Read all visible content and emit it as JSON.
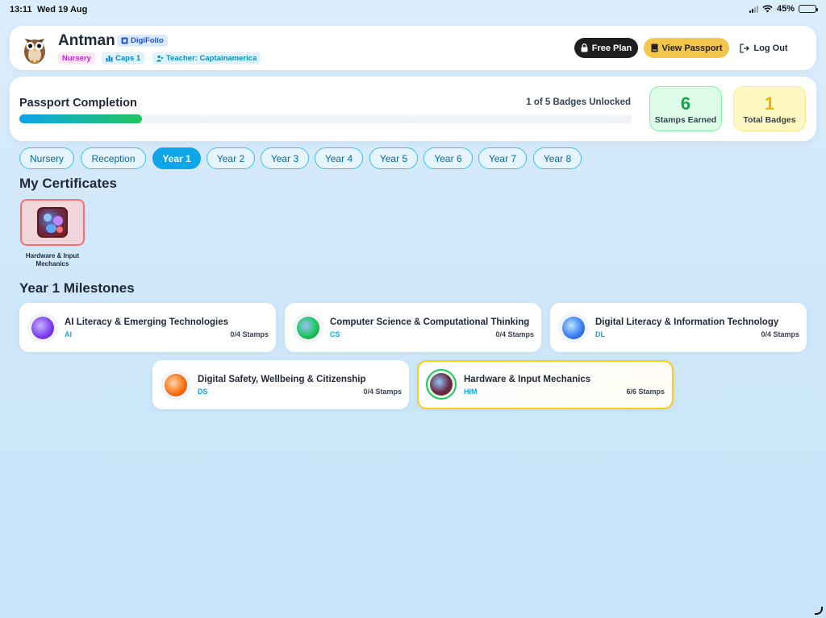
{
  "status_bar": {
    "time": "13:11",
    "date": "Wed 19 Aug",
    "battery": "45%",
    "battery_level": 0.45
  },
  "header": {
    "username": "Antman",
    "digifolio_label": "DigiFolio",
    "grade_label": "Nursery",
    "class_label": "Caps 1",
    "teacher_label": "Teacher: Captainamerica",
    "free_plan_label": "Free Plan",
    "view_passport_label": "View Passport",
    "logout_label": "Log Out"
  },
  "completion": {
    "title": "Passport Completion",
    "unlocked_text": "1 of 5 Badges Unlocked",
    "progress": 0.2,
    "stamps_earned_value": "6",
    "stamps_earned_label": "Stamps Earned",
    "total_badges_value": "1",
    "total_badges_label": "Total Badges"
  },
  "year_tabs": [
    {
      "label": "Nursery",
      "active": false
    },
    {
      "label": "Reception",
      "active": false
    },
    {
      "label": "Year 1",
      "active": true
    },
    {
      "label": "Year 2",
      "active": false
    },
    {
      "label": "Year 3",
      "active": false
    },
    {
      "label": "Year 4",
      "active": false
    },
    {
      "label": "Year 5",
      "active": false
    },
    {
      "label": "Year 6",
      "active": false
    },
    {
      "label": "Year 7",
      "active": false
    },
    {
      "label": "Year 8",
      "active": false
    }
  ],
  "certificates": {
    "title": "My Certificates",
    "items": [
      {
        "label": "Hardware & Input Mechanics"
      }
    ]
  },
  "milestones": {
    "title": "Year 1 Milestones",
    "items": [
      {
        "name": "AI Literacy & Emerging Technologies",
        "code": "AI",
        "stamps": "0/4 Stamps",
        "color": "#7c3aed"
      },
      {
        "name": "Computer Science & Computational Thinking",
        "code": "CS",
        "stamps": "0/4 Stamps",
        "color": "#16a34a"
      },
      {
        "name": "Digital Literacy & Information Technology",
        "code": "DL",
        "stamps": "0/4 Stamps",
        "color": "#2563eb"
      },
      {
        "name": "Digital Safety, Wellbeing & Citizenship",
        "code": "DS",
        "stamps": "0/4 Stamps",
        "color": "#ea580c"
      },
      {
        "name": "Hardware & Input Mechanics",
        "code": "HIM",
        "stamps": "6/6 Stamps",
        "color": "#7f1d1d"
      }
    ]
  }
}
